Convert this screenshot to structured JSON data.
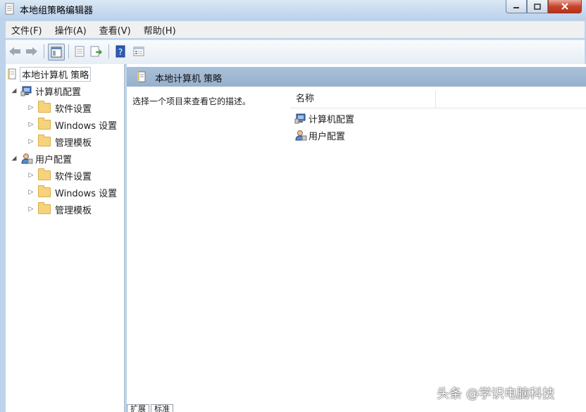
{
  "window": {
    "title": "本地组策略编辑器"
  },
  "menu": {
    "items": [
      "文件(F)",
      "操作(A)",
      "查看(V)",
      "帮助(H)"
    ]
  },
  "toolbar": {
    "icons": [
      "back-arrow-icon",
      "forward-arrow-icon",
      "show-hide-tree-icon",
      "properties-icon",
      "export-list-icon",
      "help-icon",
      "view-icon"
    ]
  },
  "tree": {
    "root": "本地计算机 策略",
    "computer": {
      "label": "计算机配置",
      "children": [
        "软件设置",
        "Windows 设置",
        "管理模板"
      ]
    },
    "user": {
      "label": "用户配置",
      "children": [
        "软件设置",
        "Windows 设置",
        "管理模板"
      ]
    }
  },
  "main": {
    "header": "本地计算机 策略",
    "description": "选择一个项目来查看它的描述。",
    "column_name": "名称",
    "items": [
      "计算机配置",
      "用户配置"
    ]
  },
  "tabs": [
    "扩展",
    "标准"
  ],
  "watermark": "头条 @学识电脑科技",
  "colors": {
    "titlebar": "#c6d9ee",
    "header_bar": "#a9c0d8",
    "folder": "#f6d37a"
  }
}
